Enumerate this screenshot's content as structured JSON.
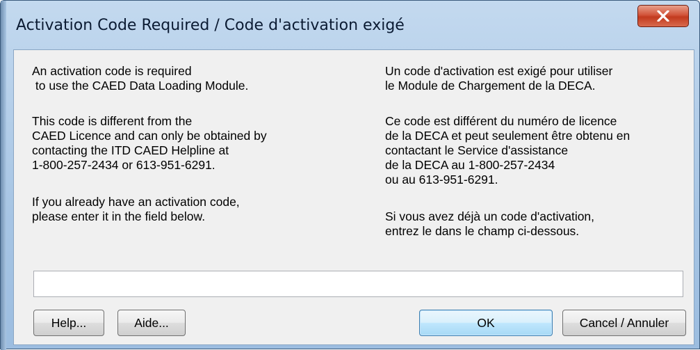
{
  "window": {
    "title": "Activation Code Required / Code d'activation exigé",
    "close_label": "X"
  },
  "english": {
    "p1": "An activation code is required\n to use the CAED Data Loading Module.",
    "p2": "This code is different from the\nCAED Licence and can only be obtained by\ncontacting the ITD CAED Helpline at\n1-800-257-2434 or 613-951-6291.",
    "p3": "If you already have an activation code,\nplease enter it in the field below."
  },
  "french": {
    "p1": "Un code d'activation est exigé pour utiliser\nle Module de Chargement de la DECA.",
    "p2": "Ce code est différent du numéro de licence\nde la DECA et peut seulement être obtenu en\ncontactant le Service d'assistance\nde la DECA au 1-800-257-2434\nou au 613-951-6291.",
    "p3": "Si vous avez déjà un code d'activation,\nentrez le dans le champ ci-dessous."
  },
  "activation_field": {
    "value": "",
    "placeholder": ""
  },
  "buttons": {
    "help": "Help...",
    "aide": "Aide...",
    "ok": "OK",
    "cancel": "Cancel / Annuler"
  },
  "colors": {
    "title_bar": "#b5d0ec",
    "close_button": "#c8452a",
    "client_background": "#f0f0f0",
    "default_button_border": "#3c7fb1"
  }
}
